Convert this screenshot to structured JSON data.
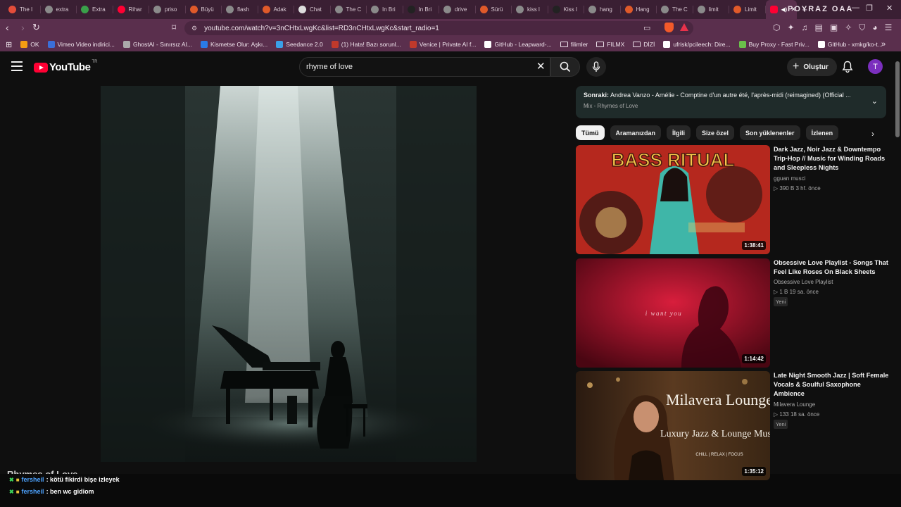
{
  "browser": {
    "tabs": [
      {
        "label": "The I",
        "color": "#e44d3a"
      },
      {
        "label": "extra",
        "color": "#8a8a8a"
      },
      {
        "label": "Extra",
        "color": "#3aa04a"
      },
      {
        "label": "Rihar",
        "color": "#ff0033"
      },
      {
        "label": "priso",
        "color": "#8a8a8a"
      },
      {
        "label": "Büyü",
        "color": "#e05a2a"
      },
      {
        "label": "flash",
        "color": "#8a8a8a"
      },
      {
        "label": "Adak",
        "color": "#e05a2a"
      },
      {
        "label": "Chat",
        "color": "#dddddd"
      },
      {
        "label": "The C",
        "color": "#8a8a8a"
      },
      {
        "label": "In Bri",
        "color": "#8a8a8a"
      },
      {
        "label": "In Bri",
        "color": "#222222"
      },
      {
        "label": "drive",
        "color": "#8a8a8a"
      },
      {
        "label": "Sürü",
        "color": "#e05a2a"
      },
      {
        "label": "kiss l",
        "color": "#8a8a8a"
      },
      {
        "label": "Kiss I",
        "color": "#222222"
      },
      {
        "label": "hang",
        "color": "#8a8a8a"
      },
      {
        "label": "Hang",
        "color": "#e05a2a"
      },
      {
        "label": "The C",
        "color": "#8a8a8a"
      },
      {
        "label": "limit",
        "color": "#8a8a8a"
      },
      {
        "label": "Limit",
        "color": "#e05a2a"
      }
    ],
    "active_tab_color": "#ff0033",
    "profile_name": "POYRAZ OAA",
    "url": "youtube.com/watch?v=3nCHtxLwgKc&list=RD3nCHtxLwgKc&start_radio=1",
    "bookmarks": [
      {
        "label": "OK",
        "color": "#f39c12"
      },
      {
        "label": "Vimeo Video indirici...",
        "color": "#3b6fd8"
      },
      {
        "label": "GhostAI - Sınırsız AI...",
        "color": "#aaaaaa"
      },
      {
        "label": "Kismetse Olur: Aşkı...",
        "color": "#2a7ae8"
      },
      {
        "label": "Seedance 2.0",
        "color": "#3aa0e8"
      },
      {
        "label": "(1) Hata! Bazı sorunl...",
        "color": "#c0392b"
      },
      {
        "label": "Venice | Private AI f...",
        "color": "#c0392b"
      },
      {
        "label": "GitHub - Leapward-...",
        "color": "#ffffff"
      },
      {
        "label": "filimler",
        "folder": true
      },
      {
        "label": "FILMX",
        "folder": true
      },
      {
        "label": "DİZİ",
        "folder": true
      },
      {
        "label": "ufrisk/pcileech: Dire...",
        "color": "#ffffff"
      },
      {
        "label": "Buy Proxy - Fast Priv...",
        "color": "#6ac04a"
      },
      {
        "label": "GitHub - xmkg/ko-t...",
        "color": "#ffffff"
      }
    ]
  },
  "youtube": {
    "logo_text": "YouTube",
    "country_code": "TR",
    "search_value": "rhyme of love",
    "create_label": "Oluştur",
    "avatar_letter": "T",
    "next": {
      "prefix": "Sonraki:",
      "title": "Andrea Vanzo - Amélie - Comptine d'un autre été, l'après-midi (reimagined) (Official ...",
      "playlist": "Mix - Rhymes of Love"
    },
    "chips": [
      "Tümü",
      "Aramanızdan",
      "İlgili",
      "Size özel",
      "Son yüklenenler",
      "İzlenen"
    ],
    "video_title": "Rhymes of Love",
    "chat": [
      {
        "user": "fersheil",
        "message": ": kötü fikirdi bişe izleyek"
      },
      {
        "user": "fersheil",
        "message": ": ben wc gidiom"
      }
    ],
    "recommendations": [
      {
        "title": "Dark Jazz, Noir Jazz & Downtempo Trip-Hop // Music for Winding Roads and Sleepless Nights",
        "channel": "gguan musci",
        "meta": "▷ 390 B   3 hf. önce",
        "duration": "1:38:41",
        "thumb_text": "BASS RITUAL",
        "badge": ""
      },
      {
        "title": "Obsessive Love Playlist - Songs That Feel Like Roses On Black Sheets",
        "channel": "Obsessive Love Playlist",
        "meta": "▷ 1 B   19 sa. önce",
        "duration": "1:14:42",
        "thumb_text": "i want you",
        "badge": "Yeni"
      },
      {
        "title": "Late Night Smooth Jazz | Soft Female Vocals & Soulful Saxophone Ambience",
        "channel": "Milavera Lounge",
        "meta": "▷ 133   18 sa. önce",
        "duration": "1:35:12",
        "thumb_text": "Milavera Lounge",
        "thumb_subtext": "Luxury Jazz & Lounge Music",
        "thumb_tags": "CHILL | RELAX | FOCUS",
        "badge": "Yeni"
      }
    ]
  }
}
